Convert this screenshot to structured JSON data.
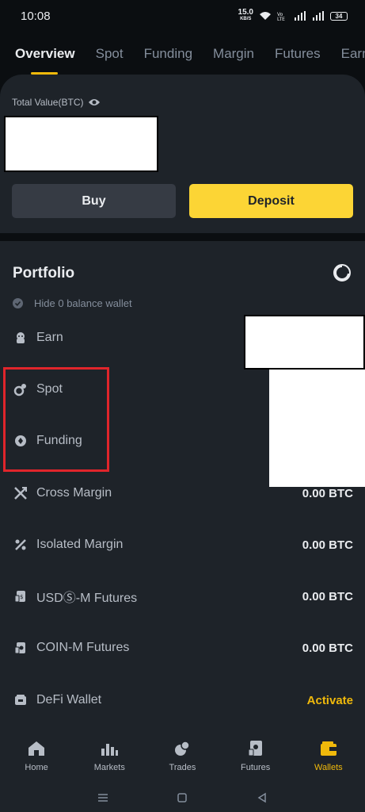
{
  "status": {
    "time": "10:08",
    "netspeed_value": "15.0",
    "netspeed_unit": "KB/S",
    "battery": "34"
  },
  "tabs": [
    "Overview",
    "Spot",
    "Funding",
    "Margin",
    "Futures",
    "Earn"
  ],
  "overview": {
    "total_label": "Total Value(BTC)",
    "buy_label": "Buy",
    "deposit_label": "Deposit"
  },
  "portfolio": {
    "title": "Portfolio",
    "hide_label": "Hide 0 balance wallet",
    "rows": [
      {
        "label": "Earn",
        "value": ""
      },
      {
        "label": "Spot",
        "value": ""
      },
      {
        "label": "Funding",
        "value": ""
      },
      {
        "label": "Cross Margin",
        "value": "0.00 BTC"
      },
      {
        "label": "Isolated Margin",
        "value": "0.00 BTC"
      },
      {
        "label": "USDⓈ-M Futures",
        "value": "0.00 BTC"
      },
      {
        "label": "COIN-M Futures",
        "value": "0.00 BTC"
      },
      {
        "label": "DeFi Wallet",
        "value": "Activate"
      }
    ]
  },
  "nav": [
    {
      "label": "Home",
      "icon": "home-icon"
    },
    {
      "label": "Markets",
      "icon": "markets-icon"
    },
    {
      "label": "Trades",
      "icon": "trades-icon"
    },
    {
      "label": "Futures",
      "icon": "futures-icon"
    },
    {
      "label": "Wallets",
      "icon": "wallet-icon"
    }
  ],
  "colors": {
    "accent": "#f0b90b",
    "card": "#1e2329",
    "bg": "#0b0e11",
    "highlight": "#e0252b"
  }
}
